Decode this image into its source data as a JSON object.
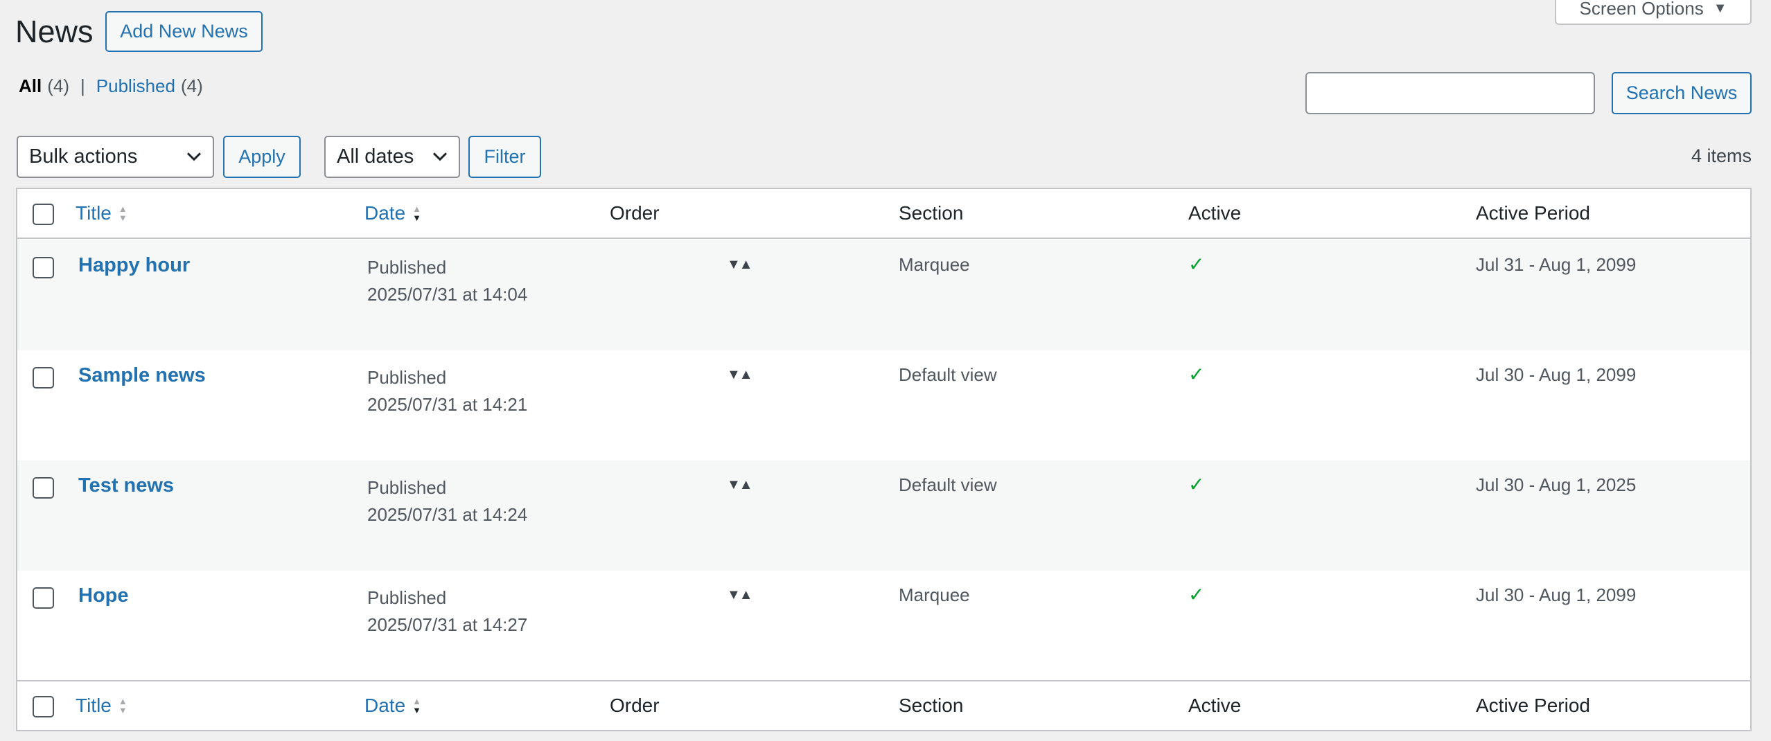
{
  "header": {
    "title": "News",
    "add_new_label": "Add New News",
    "screen_options_label": "Screen Options"
  },
  "filters": {
    "all_label": "All",
    "all_count": "(4)",
    "separator": "|",
    "published_label": "Published",
    "published_count": "(4)"
  },
  "search": {
    "value": "",
    "button_label": "Search News"
  },
  "toolbar": {
    "bulk_actions_label": "Bulk actions",
    "apply_label": "Apply",
    "dates_label": "All dates",
    "filter_label": "Filter",
    "items_count": "4 items"
  },
  "table": {
    "columns": {
      "title": "Title",
      "date": "Date",
      "order": "Order",
      "section": "Section",
      "active": "Active",
      "active_period": "Active Period"
    },
    "rows": [
      {
        "title": "Happy hour",
        "status": "Published",
        "date": "2025/07/31 at 14:04",
        "order_icon": "▼▲",
        "section": "Marquee",
        "active": "✓",
        "period": "Jul 31 - Aug 1, 2099"
      },
      {
        "title": "Sample news",
        "status": "Published",
        "date": "2025/07/31 at 14:21",
        "order_icon": "▼▲",
        "section": "Default view",
        "active": "✓",
        "period": "Jul 30 - Aug 1, 2099"
      },
      {
        "title": "Test news",
        "status": "Published",
        "date": "2025/07/31 at 14:24",
        "order_icon": "▼▲",
        "section": "Default view",
        "active": "✓",
        "period": "Jul 30 - Aug 1, 2025"
      },
      {
        "title": "Hope",
        "status": "Published",
        "date": "2025/07/31 at 14:27",
        "order_icon": "▼▲",
        "section": "Marquee",
        "active": "✓",
        "period": "Jul 30 - Aug 1, 2099"
      }
    ]
  },
  "colors": {
    "accent": "#2271b1",
    "active_check": "#00a32a",
    "background": "#f0f0f1"
  }
}
